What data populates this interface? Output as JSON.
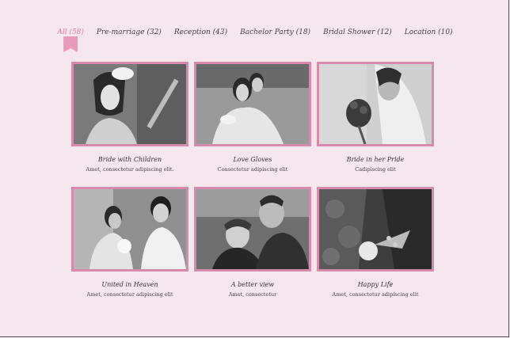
{
  "filters": [
    {
      "label": "All (58)"
    },
    {
      "label": "Pre-marriage (32)"
    },
    {
      "label": "Reception (43)"
    },
    {
      "label": "Bachelor Party (18)"
    },
    {
      "label": "Bridal Shower (12)"
    },
    {
      "label": "Location (10)"
    }
  ],
  "gallery": [
    {
      "title": "Bride with Children",
      "subtitle": "Amet, consectetur adipiscing elit."
    },
    {
      "title": "Love Gloves",
      "subtitle": "Consectetur adipiscing elit"
    },
    {
      "title": "Bride in her Pride",
      "subtitle": "Cadipiscing elit"
    },
    {
      "title": "United in Heaven",
      "subtitle": "Amet, consectetur adipiscing elit"
    },
    {
      "title": "A better view",
      "subtitle": "Amet, consectetur"
    },
    {
      "title": "Happy Life",
      "subtitle": "Amet, consectetur adipiscing elit"
    }
  ],
  "colors": {
    "accent": "#e07aa5",
    "frame": "#d88aae",
    "background": "#f6e6ee"
  }
}
